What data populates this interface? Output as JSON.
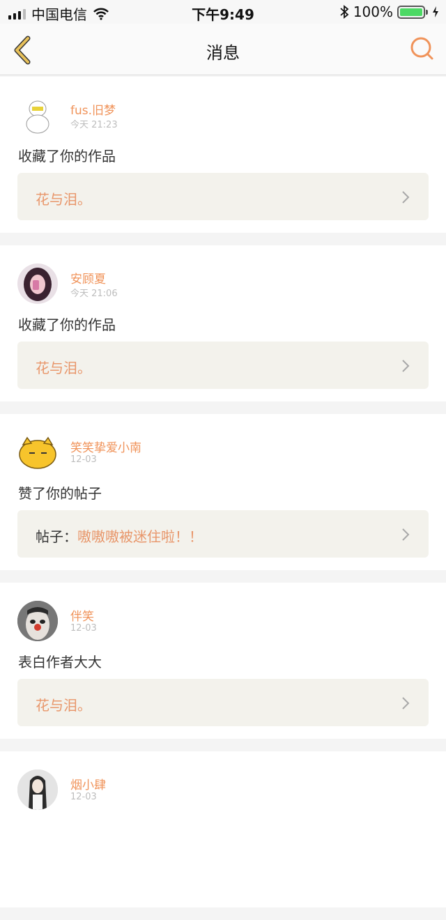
{
  "status_bar": {
    "carrier": "中国电信",
    "time": "下午9:49",
    "battery_percent": "100%"
  },
  "nav": {
    "title": "消息",
    "back_icon": "chevron-left-icon",
    "search_icon": "search-icon"
  },
  "colors": {
    "accent": "#f0935a",
    "back_arrow": "#e8c15a",
    "ref_background": "#f3f2ec"
  },
  "messages": [
    {
      "user": "fus.旧梦",
      "time": "今天 21:23",
      "action": "收藏了你的作品",
      "ref_prefix": "",
      "ref_title": "花与泪。"
    },
    {
      "user": "安顾夏",
      "time": "今天 21:06",
      "action": "收藏了你的作品",
      "ref_prefix": "",
      "ref_title": "花与泪。"
    },
    {
      "user": "笑笑挚爱小南",
      "time": "12-03",
      "action": "赞了你的帖子",
      "ref_prefix": "帖子：",
      "ref_title": "嗷嗷嗷被迷住啦！！"
    },
    {
      "user": "伴笑",
      "time": "12-03",
      "action": "表白作者大大",
      "ref_prefix": "",
      "ref_title": "花与泪。"
    },
    {
      "user": "烟小肆",
      "time": "12-03",
      "action": "",
      "ref_prefix": "",
      "ref_title": ""
    }
  ]
}
